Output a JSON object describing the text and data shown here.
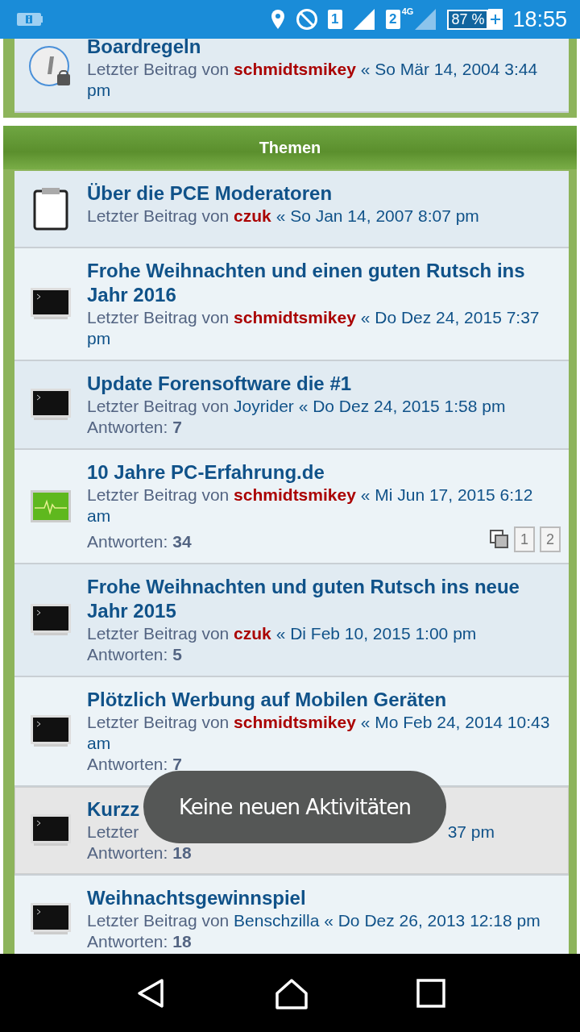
{
  "status_bar": {
    "battery": "87 %",
    "time": "18:55",
    "sim_1": "1",
    "sim_2": "2",
    "network": "4G"
  },
  "top_forum": {
    "title": "Boardregeln",
    "prefix": "Letzter Beitrag von",
    "author": "schmidtsmikey",
    "author_highlighted": true,
    "date": "« So Mär 14, 2004 3:44 pm"
  },
  "section": {
    "title": "Themen"
  },
  "topics": [
    {
      "kind": "clipboard",
      "title": "Über die PCE Moderatoren",
      "prefix": "Letzter Beitrag von",
      "author": "czuk",
      "author_highlighted": true,
      "date": "« So Jan 14, 2007 8:07 pm",
      "selected": false
    },
    {
      "kind": "terminal",
      "title": "Frohe Weihnachten und einen guten Rutsch ins Jahr 2016",
      "prefix": "Letzter Beitrag von",
      "author": "schmidtsmikey",
      "author_highlighted": true,
      "date": "« Do Dez 24, 2015 7:37 pm",
      "selected": false
    },
    {
      "kind": "terminal",
      "title": "Update Forensoftware die #1",
      "prefix": "Letzter Beitrag von",
      "author": "Joyrider",
      "author_highlighted": false,
      "date": "« Do Dez 24, 2015 1:58 pm",
      "replies_label": "Antworten:",
      "replies": "7",
      "selected": false
    },
    {
      "kind": "activity",
      "title": "10 Jahre PC-Erfahrung.de",
      "prefix": "Letzter Beitrag von",
      "author": "schmidtsmikey",
      "author_highlighted": true,
      "date": "« Mi Jun 17, 2015 6:12 am",
      "replies_label": "Antworten:",
      "replies": "34",
      "pages": [
        "1",
        "2"
      ],
      "selected": false
    },
    {
      "kind": "terminal",
      "title": "Frohe Weihnachten und guten Rutsch ins neue Jahr 2015",
      "prefix": "Letzter Beitrag von",
      "author": "czuk",
      "author_highlighted": true,
      "date": "« Di Feb 10, 2015 1:00 pm",
      "replies_label": "Antworten:",
      "replies": "5",
      "selected": false
    },
    {
      "kind": "terminal",
      "title": "Plötzlich Werbung auf Mobilen Geräten",
      "prefix": "Letzter Beitrag von",
      "author": "schmidtsmikey",
      "author_highlighted": true,
      "date": "« Mo Feb 24, 2014 10:43 am",
      "replies_label": "Antworten:",
      "replies": "7",
      "selected": false
    },
    {
      "kind": "terminal",
      "title": "Kurzz",
      "prefix": "Letzter",
      "date": "37 pm",
      "replies_label": "Antworten:",
      "replies": "18",
      "selected": true
    },
    {
      "kind": "terminal",
      "title": "Weihnachtsgewinnspiel",
      "prefix": "Letzter Beitrag von",
      "author": "Benschzilla",
      "author_highlighted": false,
      "date": "« Do Dez 26, 2013 12:18 pm",
      "replies_label": "Antworten:",
      "replies": "18",
      "selected": false
    }
  ],
  "toast": "Keine neuen Aktivitäten"
}
